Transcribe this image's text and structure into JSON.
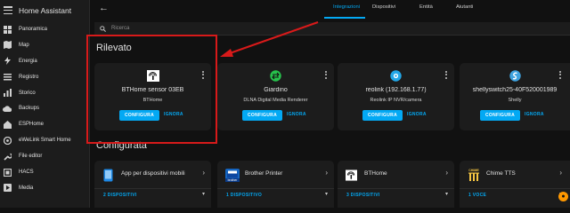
{
  "app": {
    "title": "Home Assistant"
  },
  "sidebar": {
    "items": [
      {
        "label": "Panoramica",
        "icon": "grid-icon"
      },
      {
        "label": "Map",
        "icon": "map-icon"
      },
      {
        "label": "Energia",
        "icon": "lightning-icon"
      },
      {
        "label": "Registro",
        "icon": "list-icon"
      },
      {
        "label": "Storico",
        "icon": "chart-icon"
      },
      {
        "label": "Backups",
        "icon": "cloud-icon"
      },
      {
        "label": "ESPHome",
        "icon": "esphome-icon"
      },
      {
        "label": "eWeLink Smart Home",
        "icon": "ewelink-icon"
      },
      {
        "label": "File editor",
        "icon": "wrench-icon"
      },
      {
        "label": "HACS",
        "icon": "hacs-icon"
      },
      {
        "label": "Media",
        "icon": "media-icon"
      }
    ]
  },
  "tabs": [
    {
      "label": "Integrazioni",
      "active": true
    },
    {
      "label": "Dispositivi",
      "active": false
    },
    {
      "label": "Entità",
      "active": false
    },
    {
      "label": "Aiutanti",
      "active": false
    }
  ],
  "search": {
    "placeholder": "Ricerca"
  },
  "sections": {
    "discovered": "Rilevato",
    "configured": "Configurata"
  },
  "discovered": [
    {
      "title": "BTHome sensor 03EB",
      "subtitle": "BTHome",
      "logo": "bthome-logo-icon"
    },
    {
      "title": "Giardino",
      "subtitle": "DLNA Digital Media Renderer",
      "logo": "dlna-logo-icon"
    },
    {
      "title": "reolink (192.168.1.77)",
      "subtitle": "Reolink IP NVR/camera",
      "logo": "reolink-logo-icon"
    },
    {
      "title": "shellyswitch25-40F520001989",
      "subtitle": "Shelly",
      "logo": "shelly-logo-icon"
    }
  ],
  "actions": {
    "configure": "CONFIGURA",
    "ignore": "IGNORA"
  },
  "configured": [
    {
      "name": "App per dispositivi mobili",
      "count": "2 DISPOSITIVI",
      "icon": "mobile-app-icon"
    },
    {
      "name": "Brother Printer",
      "count": "1 DISPOSITIVO",
      "icon": "brother-icon"
    },
    {
      "name": "BTHome",
      "count": "3 DISPOSITIVI",
      "icon": "bthome-logo-icon"
    },
    {
      "name": "Chime TTS",
      "count": "1 VOCE",
      "icon": "chime-icon"
    }
  ],
  "brand_labels": {
    "brother": "brother",
    "chime": "CHIME"
  },
  "colors": {
    "accent": "#03a9f4",
    "annotation": "#d81a1a",
    "sidebar_bg": "#1c1c1c",
    "card_bg": "#1c1c1c",
    "page_bg": "#111111"
  }
}
